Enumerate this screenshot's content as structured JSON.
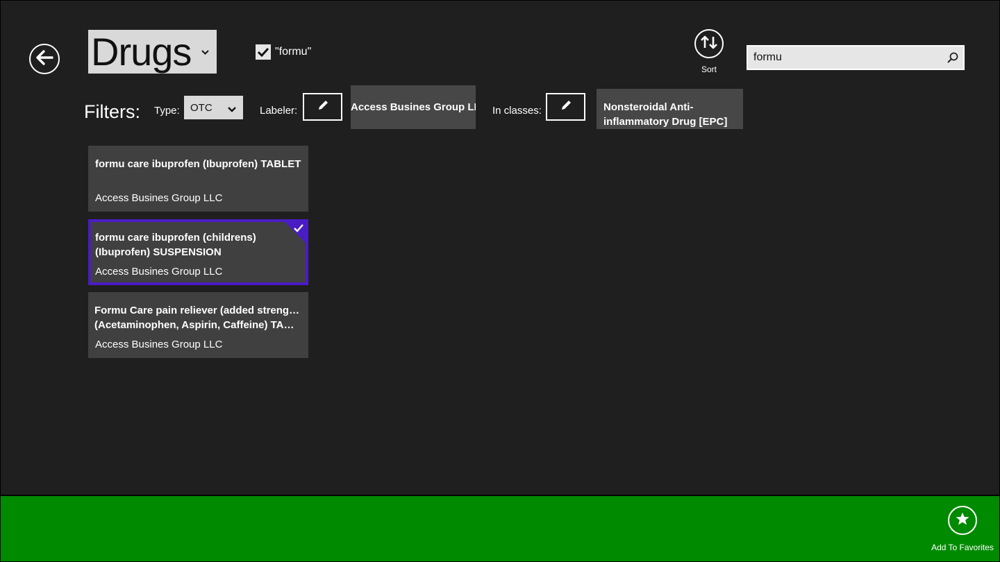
{
  "header": {
    "title": "Drugs",
    "query_filter_label": "\"formu\"",
    "query_filter_checked": true,
    "sort_label": "Sort",
    "search_value": "formu"
  },
  "filters": {
    "label": "Filters:",
    "type_label": "Type:",
    "type_value": "OTC",
    "labeler_label": "Labeler:",
    "labeler_value": "Access Busines Group LLC",
    "classes_label": "In classes:",
    "classes_value": "Nonsteroidal Anti-inflammatory Drug [EPC]"
  },
  "results": [
    {
      "name": "formu care ibuprofen (Ibuprofen) TABLET",
      "labeler": "Access Busines Group LLC",
      "selected": false
    },
    {
      "name_line1": "formu care ibuprofen (childrens)",
      "name_line2": "(Ibuprofen) SUSPENSION",
      "labeler": "Access Busines Group LLC",
      "selected": true
    },
    {
      "name_line1": "Formu Care pain reliever (added strength)",
      "name_line2": "(Acetaminophen, Aspirin, Caffeine) TABLET",
      "labeler": "Access Busines Group LLC",
      "selected": false
    }
  ],
  "app_bar": {
    "favorites_label": "Add To Favorites"
  },
  "colors": {
    "background": "#1f1f1f",
    "tile": "#404040",
    "selection_accent": "#4a1dc4",
    "app_bar": "#008a00"
  },
  "icons": [
    "back-arrow-icon",
    "chevron-down-icon",
    "checkmark-icon",
    "sort-icon",
    "search-icon",
    "pencil-icon",
    "star-icon"
  ]
}
